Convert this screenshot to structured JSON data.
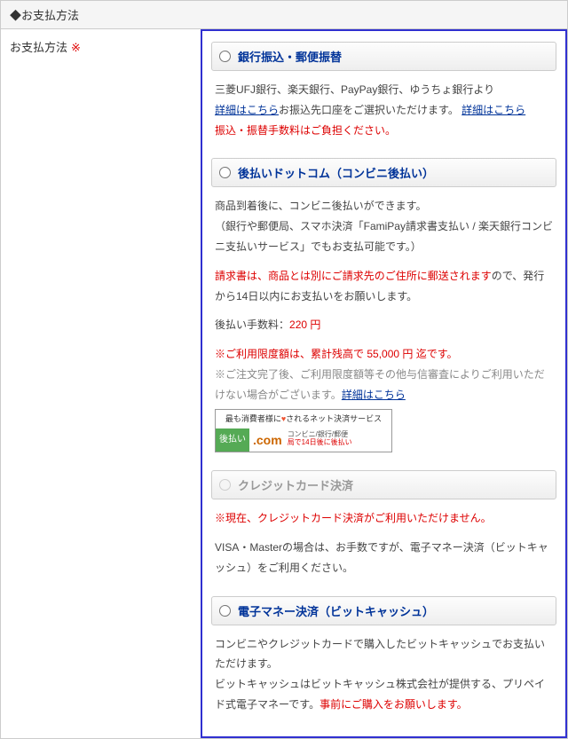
{
  "section_title": "◆お支払方法",
  "left": {
    "label": "お支払方法",
    "req": "※"
  },
  "methods": [
    {
      "label": "銀行振込・郵便振替",
      "disabled": false,
      "lines": [
        {
          "t": "三菱UFJ銀行、楽天銀行、PayPay銀行、ゆうちょ銀行より"
        },
        {
          "t": "お振込先口座をご選択いただけます。",
          "link": "詳細はこちら"
        },
        {
          "t": "振込・振替手数料はご負担ください。",
          "cls": "red"
        }
      ]
    },
    {
      "label": "後払いドットコム（コンビニ後払い）",
      "disabled": false,
      "lines": [
        {
          "t": "商品到着後に、コンビニ後払いができます。"
        },
        {
          "t": "（銀行や郵便局、スマホ決済「FamiPay請求書支払い / 楽天銀行コンビニ支払いサービス」でもお支払可能です。）"
        },
        {
          "spacer": true
        },
        {
          "parts": [
            {
              "t": "請求書は、商品とは別にご請求先のご住所に郵送されます",
              "cls": "red"
            },
            {
              "t": "ので、発行から14日以内にお支払いをお願いします。"
            }
          ]
        },
        {
          "spacer": true
        },
        {
          "parts": [
            {
              "t": "後払い手数料："
            },
            {
              "t": "220 円",
              "cls": "red"
            }
          ]
        },
        {
          "spacer": true
        },
        {
          "parts": [
            {
              "t": "※ご利用限度額は、累計残高で ",
              "cls": "red"
            },
            {
              "t": "55,000 円",
              "cls": "red"
            },
            {
              "t": " 迄です。",
              "cls": "red"
            }
          ]
        },
        {
          "parts": [
            {
              "t": "※ご注文完了後、ご利用限度額等その他与信審査によりご利用いただけない場合がございます。",
              "cls": "gray"
            },
            {
              "link": "詳細はこちら"
            }
          ]
        }
      ],
      "badge": {
        "top_a": "最も消費者様に",
        "top_heart": "♥",
        "top_b": "されるネット決済サービス",
        "icon": "後払い",
        "com": ".com",
        "desc_a": "コンビニ/銀行/郵便",
        "desc_b": "局で14日後に後払い"
      }
    },
    {
      "label": "クレジットカード決済",
      "disabled": true,
      "lines": [
        {
          "t": "※現在、クレジットカード決済がご利用いただけません。",
          "cls": "red"
        },
        {
          "spacer": true
        },
        {
          "t": "VISA・Masterの場合は、お手数ですが、電子マネー決済（ビットキャッシュ）をご利用ください。"
        }
      ]
    },
    {
      "label": "電子マネー決済（ビットキャッシュ）",
      "disabled": false,
      "lines": [
        {
          "t": "コンビニやクレジットカードで購入したビットキャッシュでお支払いただけます。"
        },
        {
          "parts": [
            {
              "t": "ビットキャッシュはビットキャッシュ株式会社が提供する、プリペイド式電子マネーです。"
            },
            {
              "t": "事前にご購入をお願いします。",
              "cls": "red"
            }
          ]
        }
      ]
    }
  ]
}
